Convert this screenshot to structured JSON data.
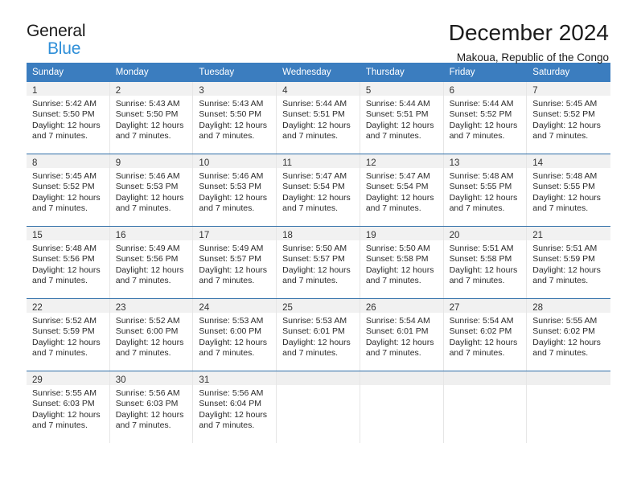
{
  "brand": {
    "line1": "General",
    "line2": "Blue",
    "triangle_color": "#1266b0",
    "blue_text_color": "#2f8fd8"
  },
  "header": {
    "title": "December 2024",
    "subtitle": "Makoua, Republic of the Congo"
  },
  "theme": {
    "header_blue": "#3b7dbf",
    "week_divider": "#2f6ea8",
    "daynum_bg": "#f1f1f1"
  },
  "calendar": {
    "weekday_headers": [
      "Sunday",
      "Monday",
      "Tuesday",
      "Wednesday",
      "Thursday",
      "Friday",
      "Saturday"
    ],
    "weeks": [
      [
        {
          "day": "1",
          "sunrise": "Sunrise: 5:42 AM",
          "sunset": "Sunset: 5:50 PM",
          "daylight": "Daylight: 12 hours and 7 minutes."
        },
        {
          "day": "2",
          "sunrise": "Sunrise: 5:43 AM",
          "sunset": "Sunset: 5:50 PM",
          "daylight": "Daylight: 12 hours and 7 minutes."
        },
        {
          "day": "3",
          "sunrise": "Sunrise: 5:43 AM",
          "sunset": "Sunset: 5:50 PM",
          "daylight": "Daylight: 12 hours and 7 minutes."
        },
        {
          "day": "4",
          "sunrise": "Sunrise: 5:44 AM",
          "sunset": "Sunset: 5:51 PM",
          "daylight": "Daylight: 12 hours and 7 minutes."
        },
        {
          "day": "5",
          "sunrise": "Sunrise: 5:44 AM",
          "sunset": "Sunset: 5:51 PM",
          "daylight": "Daylight: 12 hours and 7 minutes."
        },
        {
          "day": "6",
          "sunrise": "Sunrise: 5:44 AM",
          "sunset": "Sunset: 5:52 PM",
          "daylight": "Daylight: 12 hours and 7 minutes."
        },
        {
          "day": "7",
          "sunrise": "Sunrise: 5:45 AM",
          "sunset": "Sunset: 5:52 PM",
          "daylight": "Daylight: 12 hours and 7 minutes."
        }
      ],
      [
        {
          "day": "8",
          "sunrise": "Sunrise: 5:45 AM",
          "sunset": "Sunset: 5:52 PM",
          "daylight": "Daylight: 12 hours and 7 minutes."
        },
        {
          "day": "9",
          "sunrise": "Sunrise: 5:46 AM",
          "sunset": "Sunset: 5:53 PM",
          "daylight": "Daylight: 12 hours and 7 minutes."
        },
        {
          "day": "10",
          "sunrise": "Sunrise: 5:46 AM",
          "sunset": "Sunset: 5:53 PM",
          "daylight": "Daylight: 12 hours and 7 minutes."
        },
        {
          "day": "11",
          "sunrise": "Sunrise: 5:47 AM",
          "sunset": "Sunset: 5:54 PM",
          "daylight": "Daylight: 12 hours and 7 minutes."
        },
        {
          "day": "12",
          "sunrise": "Sunrise: 5:47 AM",
          "sunset": "Sunset: 5:54 PM",
          "daylight": "Daylight: 12 hours and 7 minutes."
        },
        {
          "day": "13",
          "sunrise": "Sunrise: 5:48 AM",
          "sunset": "Sunset: 5:55 PM",
          "daylight": "Daylight: 12 hours and 7 minutes."
        },
        {
          "day": "14",
          "sunrise": "Sunrise: 5:48 AM",
          "sunset": "Sunset: 5:55 PM",
          "daylight": "Daylight: 12 hours and 7 minutes."
        }
      ],
      [
        {
          "day": "15",
          "sunrise": "Sunrise: 5:48 AM",
          "sunset": "Sunset: 5:56 PM",
          "daylight": "Daylight: 12 hours and 7 minutes."
        },
        {
          "day": "16",
          "sunrise": "Sunrise: 5:49 AM",
          "sunset": "Sunset: 5:56 PM",
          "daylight": "Daylight: 12 hours and 7 minutes."
        },
        {
          "day": "17",
          "sunrise": "Sunrise: 5:49 AM",
          "sunset": "Sunset: 5:57 PM",
          "daylight": "Daylight: 12 hours and 7 minutes."
        },
        {
          "day": "18",
          "sunrise": "Sunrise: 5:50 AM",
          "sunset": "Sunset: 5:57 PM",
          "daylight": "Daylight: 12 hours and 7 minutes."
        },
        {
          "day": "19",
          "sunrise": "Sunrise: 5:50 AM",
          "sunset": "Sunset: 5:58 PM",
          "daylight": "Daylight: 12 hours and 7 minutes."
        },
        {
          "day": "20",
          "sunrise": "Sunrise: 5:51 AM",
          "sunset": "Sunset: 5:58 PM",
          "daylight": "Daylight: 12 hours and 7 minutes."
        },
        {
          "day": "21",
          "sunrise": "Sunrise: 5:51 AM",
          "sunset": "Sunset: 5:59 PM",
          "daylight": "Daylight: 12 hours and 7 minutes."
        }
      ],
      [
        {
          "day": "22",
          "sunrise": "Sunrise: 5:52 AM",
          "sunset": "Sunset: 5:59 PM",
          "daylight": "Daylight: 12 hours and 7 minutes."
        },
        {
          "day": "23",
          "sunrise": "Sunrise: 5:52 AM",
          "sunset": "Sunset: 6:00 PM",
          "daylight": "Daylight: 12 hours and 7 minutes."
        },
        {
          "day": "24",
          "sunrise": "Sunrise: 5:53 AM",
          "sunset": "Sunset: 6:00 PM",
          "daylight": "Daylight: 12 hours and 7 minutes."
        },
        {
          "day": "25",
          "sunrise": "Sunrise: 5:53 AM",
          "sunset": "Sunset: 6:01 PM",
          "daylight": "Daylight: 12 hours and 7 minutes."
        },
        {
          "day": "26",
          "sunrise": "Sunrise: 5:54 AM",
          "sunset": "Sunset: 6:01 PM",
          "daylight": "Daylight: 12 hours and 7 minutes."
        },
        {
          "day": "27",
          "sunrise": "Sunrise: 5:54 AM",
          "sunset": "Sunset: 6:02 PM",
          "daylight": "Daylight: 12 hours and 7 minutes."
        },
        {
          "day": "28",
          "sunrise": "Sunrise: 5:55 AM",
          "sunset": "Sunset: 6:02 PM",
          "daylight": "Daylight: 12 hours and 7 minutes."
        }
      ],
      [
        {
          "day": "29",
          "sunrise": "Sunrise: 5:55 AM",
          "sunset": "Sunset: 6:03 PM",
          "daylight": "Daylight: 12 hours and 7 minutes."
        },
        {
          "day": "30",
          "sunrise": "Sunrise: 5:56 AM",
          "sunset": "Sunset: 6:03 PM",
          "daylight": "Daylight: 12 hours and 7 minutes."
        },
        {
          "day": "31",
          "sunrise": "Sunrise: 5:56 AM",
          "sunset": "Sunset: 6:04 PM",
          "daylight": "Daylight: 12 hours and 7 minutes."
        },
        {
          "day": "",
          "sunrise": "",
          "sunset": "",
          "daylight": ""
        },
        {
          "day": "",
          "sunrise": "",
          "sunset": "",
          "daylight": ""
        },
        {
          "day": "",
          "sunrise": "",
          "sunset": "",
          "daylight": ""
        },
        {
          "day": "",
          "sunrise": "",
          "sunset": "",
          "daylight": ""
        }
      ]
    ]
  }
}
